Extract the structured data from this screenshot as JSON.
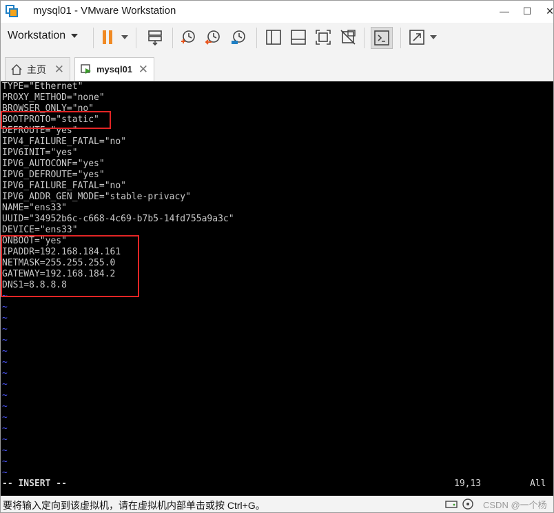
{
  "window": {
    "title": "mysql01 - VMware Workstation",
    "minimize_glyph": "—",
    "maximize_glyph": "☐",
    "close_glyph": "✕"
  },
  "toolbar": {
    "workstation_menu": "Workstation",
    "icons": [
      "pause-icon",
      "send-ctrl-alt-del-icon",
      "snapshot-icon",
      "revert-snapshot-icon",
      "snapshot-manager-icon",
      "library-icon",
      "thumbnail-icon",
      "fullscreen-icon",
      "unity-icon",
      "console-icon",
      "stretch-icon"
    ]
  },
  "tabs": [
    {
      "label": "主页",
      "icon": "home-icon"
    },
    {
      "label": "mysql01",
      "icon": "vm-icon"
    }
  ],
  "terminal": {
    "lines": [
      "TYPE=\"Ethernet\"",
      "PROXY_METHOD=\"none\"",
      "BROWSER_ONLY=\"no\"",
      "BOOTPROTO=\"static\"",
      "DEFROUTE=\"yes\"",
      "IPV4_FAILURE_FATAL=\"no\"",
      "IPV6INIT=\"yes\"",
      "IPV6_AUTOCONF=\"yes\"",
      "IPV6_DEFROUTE=\"yes\"",
      "IPV6_FAILURE_FATAL=\"no\"",
      "IPV6_ADDR_GEN_MODE=\"stable-privacy\"",
      "NAME=\"ens33\"",
      "UUID=\"34952b6c-c668-4c69-b7b5-14fd755a9a3c\"",
      "DEVICE=\"ens33\"",
      "ONBOOT=\"yes\"",
      "IPADDR=192.168.184.161",
      "NETMASK=255.255.255.0",
      "GATEWAY=192.168.184.2",
      "DNS1=8.8.8.8"
    ],
    "tilde": "~",
    "mode": "-- INSERT --",
    "cursor_position": "19,13",
    "scroll_position": "All"
  },
  "statusbar": {
    "message": "要将输入定向到该虚拟机，请在虚拟机内部单击或按 Ctrl+G。",
    "watermark": "CSDN @一个杨"
  },
  "colors": {
    "highlight": "#e32525",
    "tilde": "#4d58ff",
    "pause_orange": "#f08a24"
  }
}
